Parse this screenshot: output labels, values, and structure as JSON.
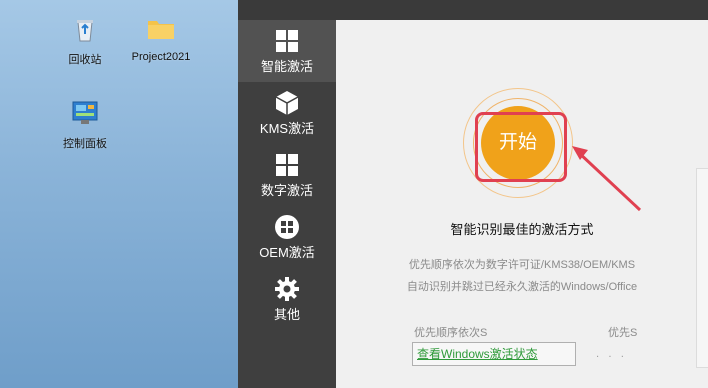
{
  "desktop": {
    "icons": [
      {
        "label": "回收站",
        "icon": "recycle-bin-icon"
      },
      {
        "label": "Project2021",
        "icon": "folder-icon"
      },
      {
        "label": "控制面板",
        "icon": "control-panel-icon"
      }
    ]
  },
  "sidebar": {
    "items": [
      {
        "label": "智能激活",
        "icon": "windows-icon",
        "active": true
      },
      {
        "label": "KMS激活",
        "icon": "cube-icon"
      },
      {
        "label": "数字激活",
        "icon": "grid-icon"
      },
      {
        "label": "OEM激活",
        "icon": "windows-logo-icon"
      },
      {
        "label": "其他",
        "icon": "gear-icon"
      }
    ]
  },
  "main": {
    "start_label": "开始",
    "subtitle": "智能识别最佳的激活方式",
    "desc_line1": "优先顺序依次为数字许可证/KMS38/OEM/KMS",
    "desc_line2": "自动识别并跳过已经永久激活的Windows/Office",
    "faded_left": "优先顺序依次S",
    "faded_right": "优先S",
    "bottom_link": "查看Windows激活状态"
  },
  "colors": {
    "accent": "#f0a21a",
    "highlight": "#e04050",
    "sidebar": "#3f3f3f",
    "link": "#2f9a3a"
  }
}
